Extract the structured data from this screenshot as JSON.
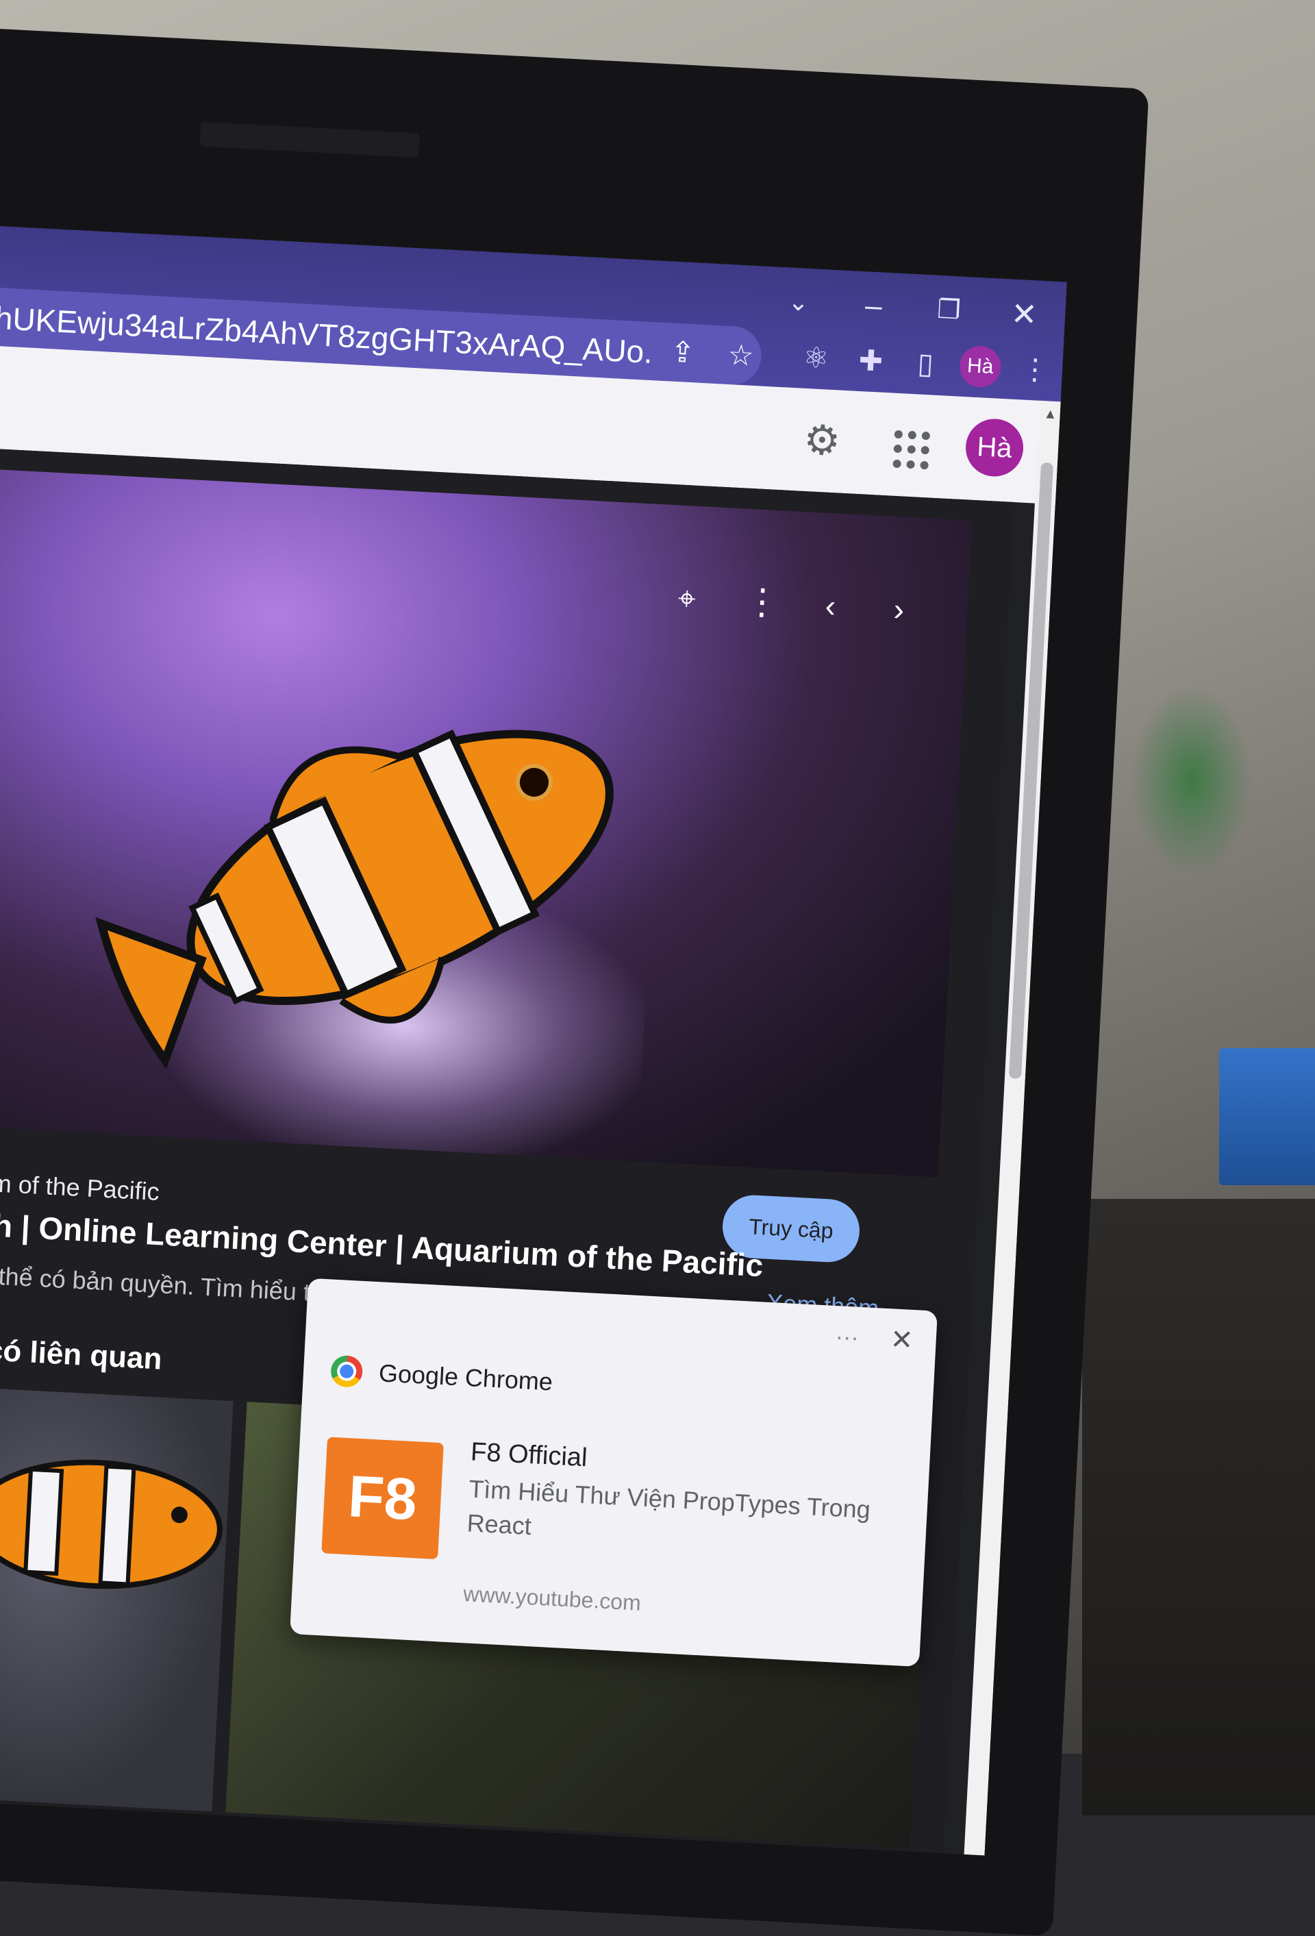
{
  "browser": {
    "url": "hUKEwju34aLrZb4AhVT8zgGHT3xArAQ_AUo...",
    "profile_initials": "Hà",
    "icons": {
      "tab_search": "chevron-down-icon",
      "minimize": "minimize-icon",
      "restore": "restore-icon",
      "close": "close-icon",
      "share": "share-icon",
      "bookmark": "star-icon",
      "react_devtools": "react-icon",
      "extensions": "puzzle-icon",
      "side_panel": "side-panel-icon",
      "menu": "kebab-menu-icon"
    },
    "accent": "#4b45a0"
  },
  "google_header": {
    "account_initials": "Hà",
    "icons": [
      "gear-icon",
      "apps-grid-icon"
    ],
    "avatar_color": "#a2259e"
  },
  "viewer": {
    "source": "arium of the Pacific",
    "title": "Fish | Online Learning Center | Aquarium of the Pacific",
    "visit_label": "Truy cập",
    "copyright_notice": "n có thể có bản quyền. Tìm hiểu thêm",
    "see_more_label": "Xem thêm",
    "related_heading": "nh có liên quan",
    "icons": [
      "lens-icon",
      "more-vertical-icon",
      "chevron-left-icon",
      "chevron-right-icon"
    ],
    "link_color": "#8ab4f8"
  },
  "notification": {
    "app_name": "Google Chrome",
    "channel": "F8 Official",
    "body": "Tìm Hiểu Thư Viện PropTypes Trong React",
    "source": "www.youtube.com",
    "logo_text": "F8",
    "more_label": "···",
    "logo_color": "#f07b22"
  }
}
